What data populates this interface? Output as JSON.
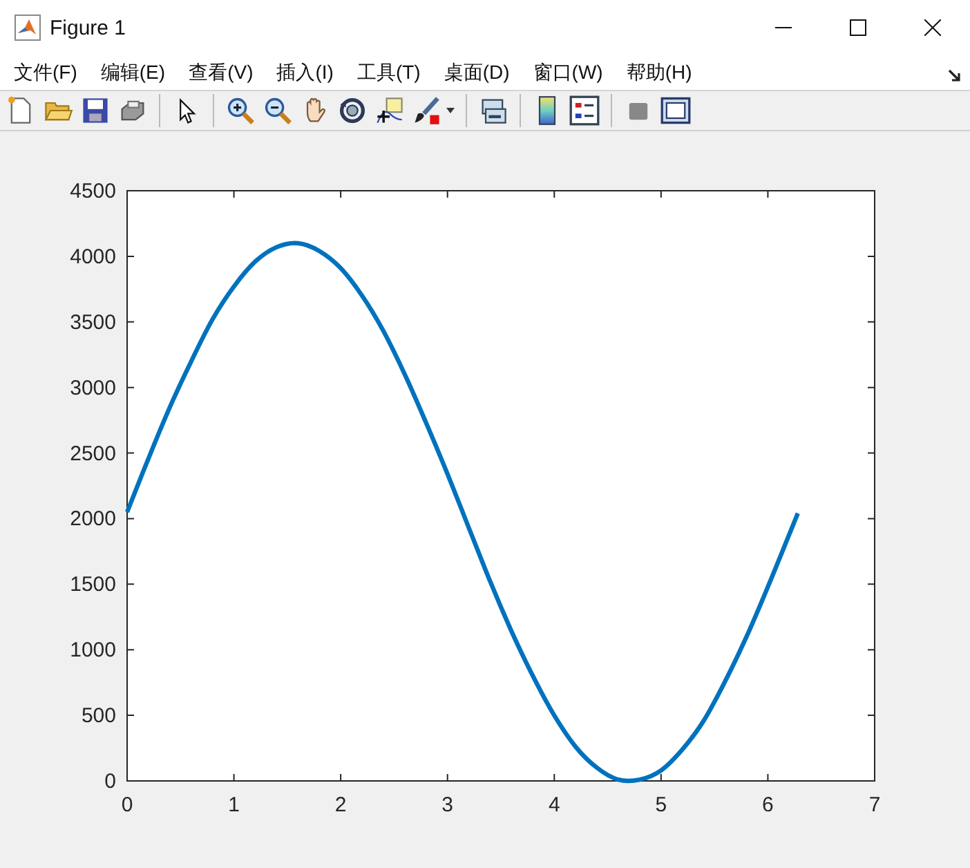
{
  "window": {
    "title": "Figure 1"
  },
  "menu": [
    "文件(F)",
    "编辑(E)",
    "查看(V)",
    "插入(I)",
    "工具(T)",
    "桌面(D)",
    "窗口(W)",
    "帮助(H)"
  ],
  "plot": {
    "chart_data": {
      "type": "line",
      "x": [
        0,
        0.2,
        0.4,
        0.6,
        0.8,
        1.0,
        1.2,
        1.4,
        1.6,
        1.8,
        2.0,
        2.2,
        2.4,
        2.6,
        2.8,
        3.0,
        3.2,
        3.4,
        3.6,
        3.8,
        4.0,
        4.2,
        4.4,
        4.6,
        4.8,
        5.0,
        5.2,
        5.4,
        5.6,
        5.8,
        6.0,
        6.2,
        6.28
      ],
      "series": [
        {
          "color": "#0072bd",
          "values": [
            2050,
            2460,
            2850,
            3200,
            3520,
            3770,
            3960,
            4070,
            4100,
            4040,
            3910,
            3700,
            3430,
            3100,
            2730,
            2340,
            1930,
            1520,
            1140,
            800,
            500,
            260,
            100,
            10,
            10,
            80,
            240,
            460,
            760,
            1100,
            1480,
            1880,
            2040
          ]
        }
      ],
      "xlim": [
        0,
        7
      ],
      "ylim": [
        0,
        4500
      ],
      "xticks": [
        0,
        1,
        2,
        3,
        4,
        5,
        6,
        7
      ],
      "yticks": [
        0,
        500,
        1000,
        1500,
        2000,
        2500,
        3000,
        3500,
        4000,
        4500
      ]
    }
  }
}
